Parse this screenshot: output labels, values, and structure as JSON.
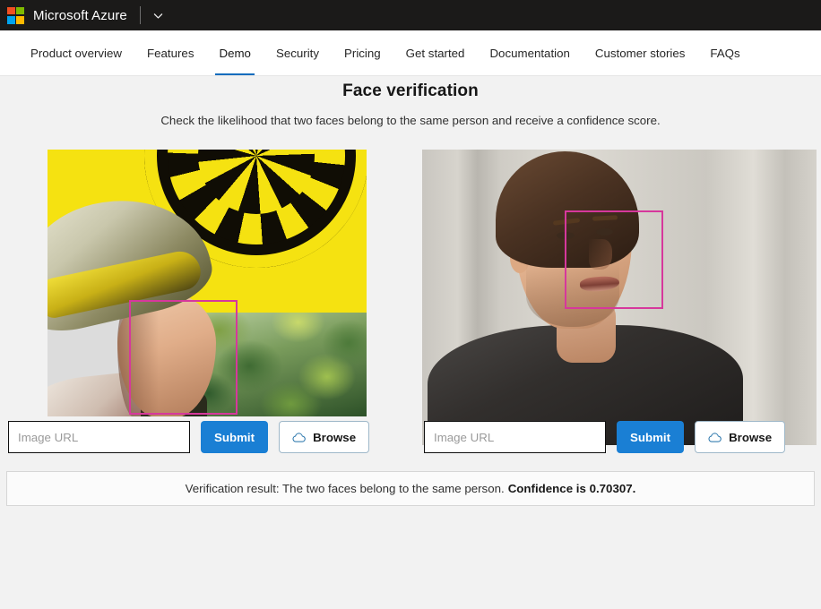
{
  "header": {
    "brand": "Microsoft Azure",
    "logo_colors": [
      "#f25022",
      "#7fba00",
      "#00a4ef",
      "#ffb900"
    ],
    "chevron_icon": "chevron-down-icon"
  },
  "nav": {
    "tabs": [
      {
        "label": "Product overview",
        "active": false
      },
      {
        "label": "Features",
        "active": false
      },
      {
        "label": "Demo",
        "active": true
      },
      {
        "label": "Security",
        "active": false
      },
      {
        "label": "Pricing",
        "active": false
      },
      {
        "label": "Get started",
        "active": false
      },
      {
        "label": "Documentation",
        "active": false
      },
      {
        "label": "Customer stories",
        "active": false
      },
      {
        "label": "FAQs",
        "active": false
      }
    ],
    "active_indicator_color": "#0f6cbd"
  },
  "main": {
    "title": "Face verification",
    "subtitle": "Check the likelihood that two faces belong to the same person and receive a confidence score.",
    "face_box_color": "#d6389c",
    "images": [
      {
        "alt": "Person wearing a helmet and goggles in front of a yellow banner with a black circular emblem, green foliage behind",
        "face_box_detected": true
      },
      {
        "alt": "Young man with curly brown hair wearing a dark jacket in front of a light beige wall",
        "face_box_detected": true
      }
    ]
  },
  "controls": {
    "left": {
      "input_value": "",
      "input_placeholder": "Image URL",
      "submit_label": "Submit",
      "browse_label": "Browse",
      "browse_icon": "cloud-upload-icon"
    },
    "right": {
      "input_value": "",
      "input_placeholder": "Image URL",
      "submit_label": "Submit",
      "browse_label": "Browse",
      "browse_icon": "cloud-upload-icon"
    },
    "submit_color": "#1a7fd4"
  },
  "result": {
    "text": "Verification result: The two faces belong to the same person.",
    "confidence": "Confidence is 0.70307.",
    "confidence_value": 0.70307
  }
}
